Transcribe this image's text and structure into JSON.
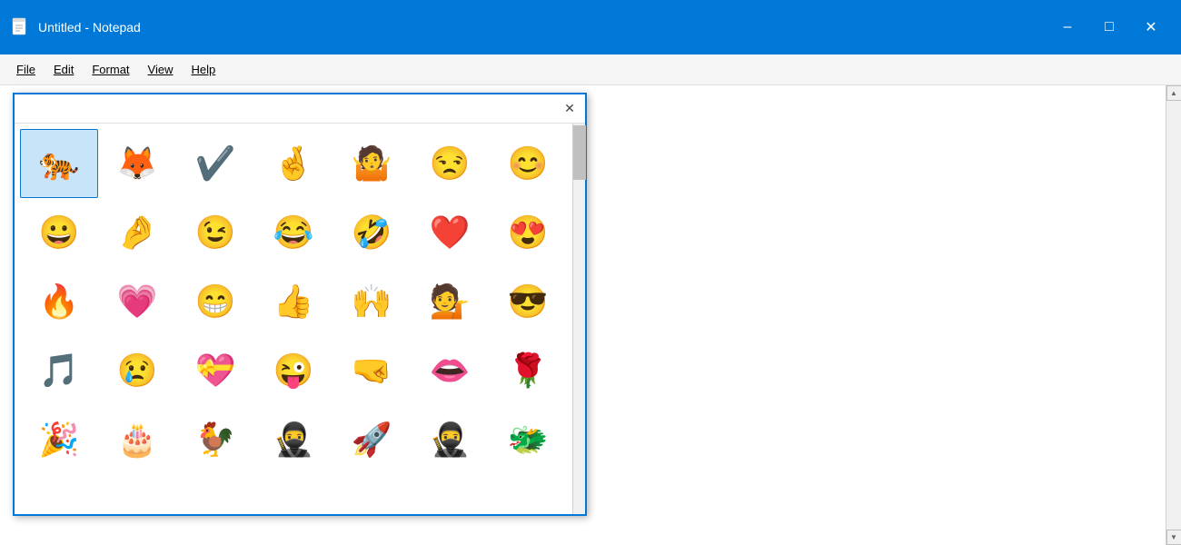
{
  "titleBar": {
    "title": "Untitled - Notepad",
    "minimizeLabel": "–",
    "maximizeLabel": "□",
    "closeLabel": "✕"
  },
  "menuBar": {
    "items": [
      {
        "label": "File",
        "id": "file"
      },
      {
        "label": "Edit",
        "id": "edit"
      },
      {
        "label": "Format",
        "id": "format"
      },
      {
        "label": "View",
        "id": "view"
      },
      {
        "label": "Help",
        "id": "help"
      }
    ]
  },
  "emojiDialog": {
    "closeLabel": "✕",
    "emojis": [
      "🐅",
      "🦊",
      "✔️",
      "🤞",
      "🤷",
      "😒",
      "😊",
      "😀",
      "🤌",
      "😉",
      "😂",
      "🤣",
      "❤️",
      "😍",
      "🔥",
      "💗",
      "😁",
      "👍",
      "🙌",
      "💁",
      "😎",
      "🎵",
      "😢",
      "💝",
      "😜",
      "🤜",
      "👄",
      "🌹",
      "🎉",
      "🎂",
      "🐓",
      "🥷",
      "🚀",
      "🥷",
      "🐲"
    ]
  }
}
